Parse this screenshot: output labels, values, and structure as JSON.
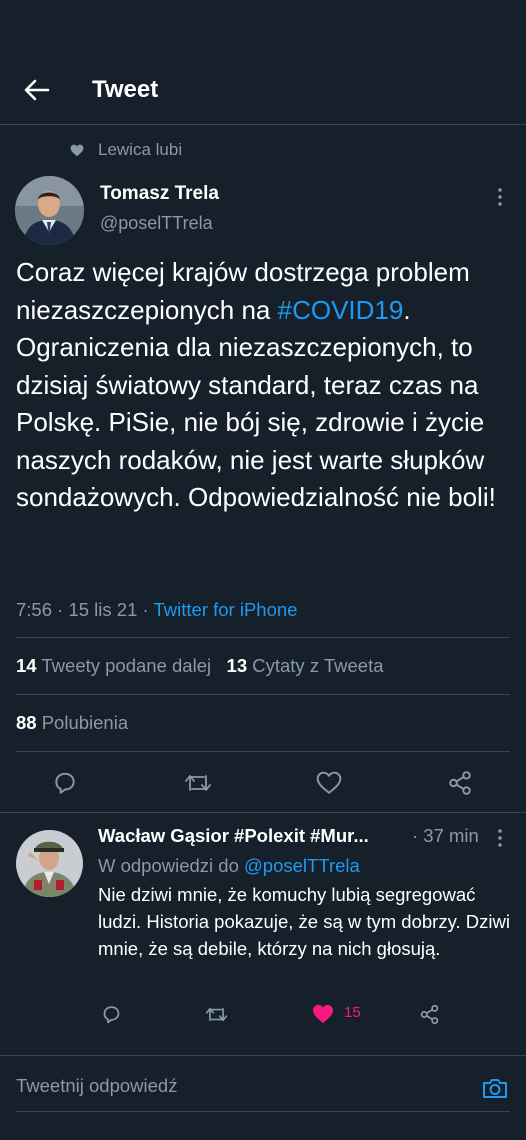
{
  "header": {
    "title": "Tweet"
  },
  "social_context": {
    "text": "Lewica lubi"
  },
  "author": {
    "name": "Tomasz Trela",
    "handle": "@poselTTrela"
  },
  "tweet": {
    "text_before_hashtag": "Coraz więcej krajów dostrzega problem niezaszczepionych na ",
    "hashtag": "#COVID19",
    "text_after_hashtag": ". Ograniczenia dla niezaszczepionych, to dzisiaj światowy standard, teraz czas na Polskę. PiSie, nie bój się, zdrowie i życie naszych rodaków, nie jest warte słupków sondażowych. Odpowiedzialność nie boli!",
    "time": "7:56",
    "dot1": "·",
    "date": "15 lis 21",
    "dot2": "·",
    "source": "Twitter for iPhone"
  },
  "stats": {
    "retweets_count": "14",
    "retweets_label": "Tweety podane dalej",
    "quotes_count": "13",
    "quotes_label": "Cytaty z Tweeta",
    "likes_count": "88",
    "likes_label": "Polubienia"
  },
  "reply": {
    "name": "Wacław Gąsior #Polexit #Mur...",
    "time": "· 37 min",
    "context_prefix": "W odpowiedzi do",
    "context_handle": "@poselTTrela",
    "text": "Nie dziwi mnie, że komuchy lubią segregować ludzi. Historia pokazuje, że są w tym dobrzy. Dziwi mnie, że są debile, którzy na nich głosują.",
    "likes": "15"
  },
  "compose": {
    "placeholder": "Tweetnij odpowiedź"
  },
  "colors": {
    "background": "#15202b",
    "accent": "#1d9bf0",
    "muted": "#8b98a5",
    "like": "#f91880",
    "divider": "#38444d"
  },
  "icons": [
    "back-arrow-icon",
    "heart-icon",
    "more-icon",
    "reply-icon",
    "retweet-icon",
    "share-icon",
    "camera-icon"
  ]
}
